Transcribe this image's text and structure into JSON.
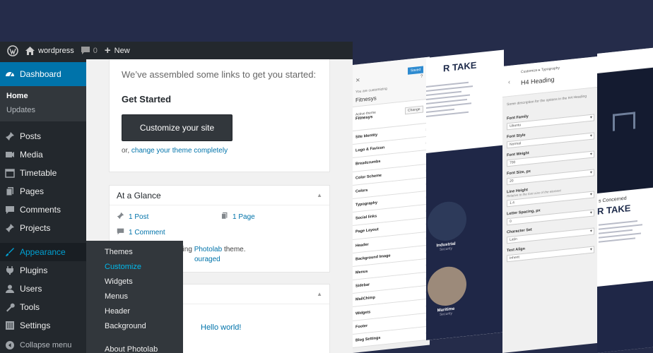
{
  "adminbar": {
    "site": "wordpress",
    "comments_count": "0",
    "new_label": "New"
  },
  "sidebar": {
    "dashboard": "Dashboard",
    "dash_sub": [
      "Home",
      "Updates"
    ],
    "items": [
      "Posts",
      "Media",
      "Timetable",
      "Pages",
      "Comments",
      "Projects"
    ],
    "appearance": "Appearance",
    "items2": [
      "Plugins",
      "Users",
      "Tools",
      "Settings"
    ],
    "collapse": "Collapse menu"
  },
  "flyout": [
    "Themes",
    "Customize",
    "Widgets",
    "Menus",
    "Header",
    "Background",
    "About Photolab"
  ],
  "welcome": {
    "assembled": "We’ve assembled some links to get you started:",
    "get_started": "Get Started",
    "customize_btn": "Customize your site",
    "or": "or,",
    "change_theme": "change your theme completely"
  },
  "glance": {
    "title": "At a Glance",
    "post": "1 Post",
    "page": "1 Page",
    "comment": "1 Comment",
    "running": "ning",
    "theme": "Photolab",
    "theme_suffix": "theme.",
    "encouraged": "ouraged"
  },
  "activity": {
    "hello": "Hello world!"
  },
  "customizer": {
    "saved": "Saved",
    "customizing": "You are customizing",
    "site_title": "Fitnesys",
    "active_theme": "Active theme",
    "theme_name": "Fitnesys",
    "change": "Change",
    "sections": [
      "Site Identity",
      "Logo & Favicon",
      "Breadcrumbs",
      "Color Scheme",
      "Colors",
      "Typography",
      "Social links",
      "Page Layout",
      "Header",
      "Background Image",
      "Menus",
      "Sidebar",
      "MailChimp",
      "Widgets",
      "Footer",
      "Blog Settings"
    ]
  },
  "preview1": {
    "take": "R TAKE",
    "p1": "Industrial",
    "p1s": "Security",
    "p2": "Maritime",
    "p2s": "Security"
  },
  "typo": {
    "crumb": "Customize ▸ Typography",
    "title": "H4 Heading",
    "desc": "Some description for the options in the H4 Heading",
    "fields": [
      {
        "label": "Font Family",
        "note": "",
        "value": "Ubuntu"
      },
      {
        "label": "Font Style",
        "note": "",
        "value": "Normal"
      },
      {
        "label": "Font Weight",
        "note": "",
        "value": "700"
      },
      {
        "label": "Font Size, px",
        "note": "",
        "value": "20"
      },
      {
        "label": "Line Height",
        "note": "Relative to the font-size of the element",
        "value": "1.4"
      },
      {
        "label": "Letter Spacing, px",
        "note": "",
        "value": "0"
      },
      {
        "label": "Character Set",
        "note": "",
        "value": "Latin"
      },
      {
        "label": "Text Align",
        "note": "",
        "value": "Inherit"
      }
    ]
  },
  "preview2": {
    "concerned": "s Concerned",
    "take": "R TAKE"
  }
}
